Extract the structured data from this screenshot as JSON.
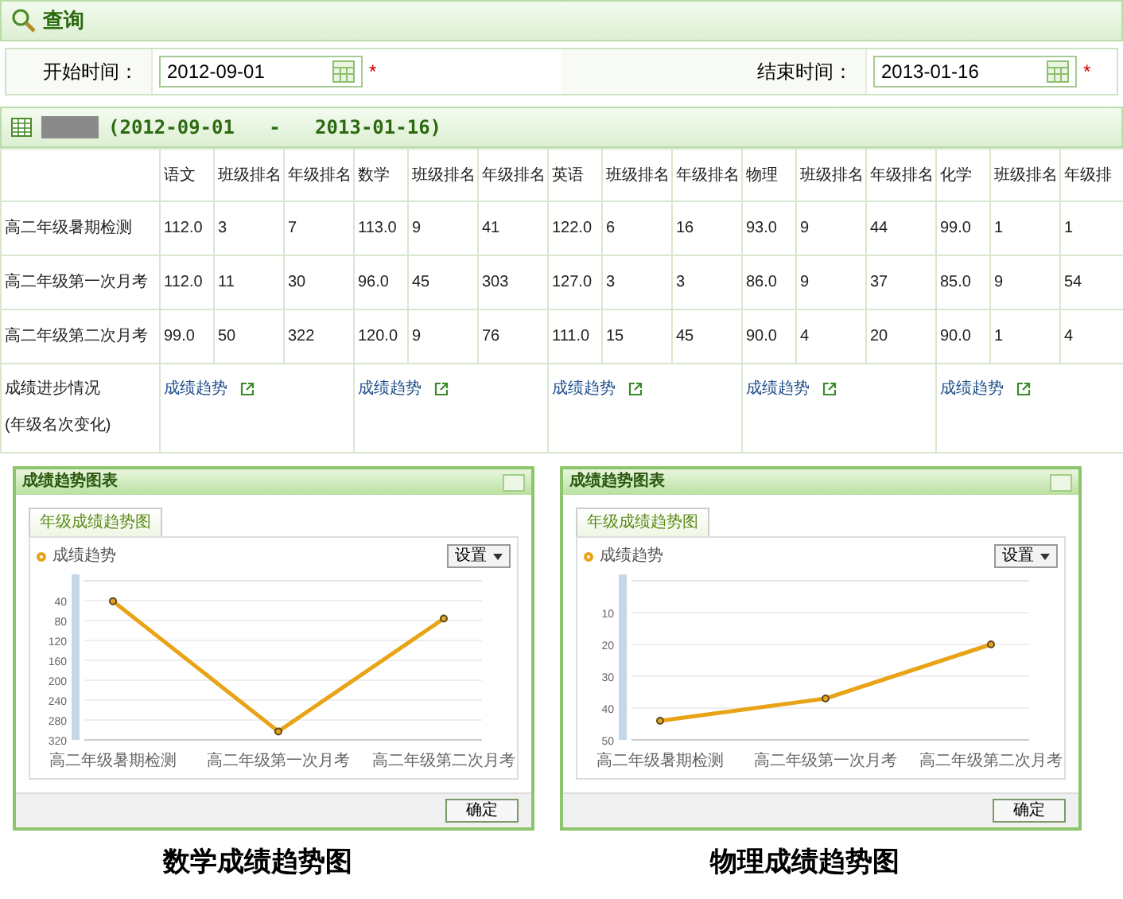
{
  "query": {
    "title": "查询",
    "fields": [
      {
        "label": "开始时间：",
        "value": "2012-09-01",
        "required_mark": "*"
      },
      {
        "label": "结束时间：",
        "value": "2013-01-16",
        "required_mark": "*"
      }
    ]
  },
  "results": {
    "range": "(2012-09-01   -   2013-01-16)",
    "columns": [
      "语文",
      "班级排名",
      "年级排名",
      "数学",
      "班级排名",
      "年级排名",
      "英语",
      "班级排名",
      "年级排名",
      "物理",
      "班级排名",
      "年级排名",
      "化学",
      "班级排名",
      "年级排"
    ],
    "rows": [
      {
        "name": "高二年级暑期检测",
        "cells": [
          "112.0",
          "3",
          "7",
          "113.0",
          "9",
          "41",
          "122.0",
          "6",
          "16",
          "93.0",
          "9",
          "44",
          "99.0",
          "1",
          "1"
        ]
      },
      {
        "name": "高二年级第一次月考",
        "cells": [
          "112.0",
          "11",
          "30",
          "96.0",
          "45",
          "303",
          "127.0",
          "3",
          "3",
          "86.0",
          "9",
          "37",
          "85.0",
          "9",
          "54"
        ]
      },
      {
        "name": "高二年级第二次月考",
        "cells": [
          "99.0",
          "50",
          "322",
          "120.0",
          "9",
          "76",
          "111.0",
          "15",
          "45",
          "90.0",
          "4",
          "20",
          "90.0",
          "1",
          "4"
        ]
      }
    ],
    "progress": {
      "label": "成绩进步情况",
      "note": "(年级名次变化)",
      "links": [
        "成绩趋势",
        "成绩趋势",
        "成绩趋势",
        "成绩趋势",
        "成绩趋势"
      ]
    }
  },
  "charts": [
    {
      "window_title": "成绩趋势图表",
      "tab": "年级成绩趋势图",
      "settings_button": "设置",
      "ok_button": "确定",
      "caption": "数学成绩趋势图",
      "chart_data": {
        "type": "line",
        "categories": [
          "高二年级暑期检测",
          "高二年级第一次月考",
          "高二年级第二次月考"
        ],
        "ylim": [
          320,
          0
        ],
        "grid": true,
        "yticks": [
          40,
          80,
          120,
          160,
          200,
          240,
          280,
          320
        ],
        "series": [
          {
            "name": "成绩趋势",
            "color": "#e8a317",
            "values": [
              41,
              303,
              76
            ],
            "marker": "circle"
          }
        ]
      }
    },
    {
      "window_title": "成绩趋势图表",
      "tab": "年级成绩趋势图",
      "settings_button": "设置",
      "ok_button": "确定",
      "caption": "物理成绩趋势图",
      "chart_data": {
        "type": "line",
        "categories": [
          "高二年级暑期检测",
          "高二年级第一次月考",
          "高二年级第二次月考"
        ],
        "ylim": [
          50,
          0
        ],
        "grid": true,
        "yticks": [
          10,
          20,
          30,
          40,
          50
        ],
        "series": [
          {
            "name": "成绩趋势",
            "color": "#e8a317",
            "values": [
              44,
              37,
              20
            ],
            "marker": "circle"
          }
        ]
      }
    }
  ]
}
